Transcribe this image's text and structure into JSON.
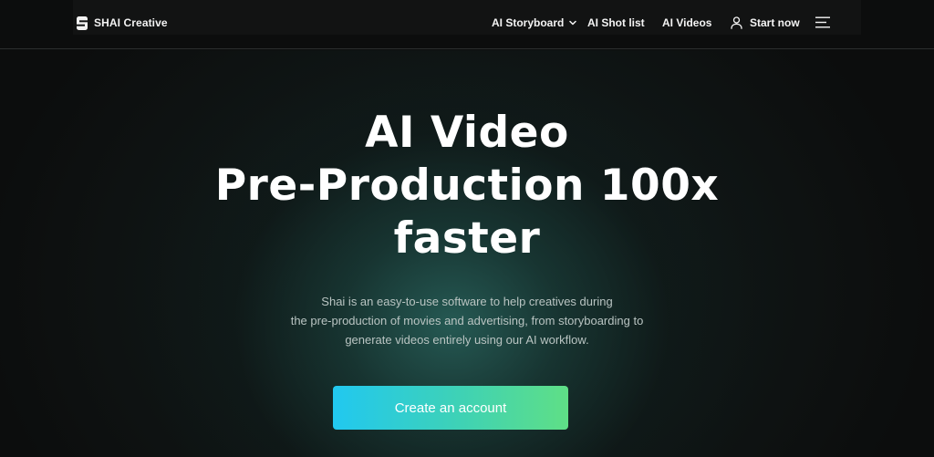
{
  "brand": {
    "name": "SHAI Creative",
    "logo_icon": "shai-logo-icon"
  },
  "nav": {
    "links": [
      {
        "label": "AI Storyboard",
        "has_dropdown": true
      },
      {
        "label": "AI Shot list"
      },
      {
        "label": "AI Videos"
      },
      {
        "label": "Start now",
        "icon": "user-icon"
      }
    ],
    "menu_icon": "hamburger-menu-icon"
  },
  "hero": {
    "headline_lines": [
      "AI Video",
      "Pre-Production 100x",
      "faster"
    ],
    "subtext_lines": [
      "Shai is an easy-to-use software to help creatives during",
      "the pre-production of movies and advertising, from storyboarding to",
      "generate videos entirely using our AI workflow."
    ],
    "cta_label": "Create an account"
  },
  "colors": {
    "background": "#0c0d0d",
    "glow": "#265c56",
    "cta_gradient_start": "#21c8f0",
    "cta_gradient_end": "#5fdf86"
  }
}
